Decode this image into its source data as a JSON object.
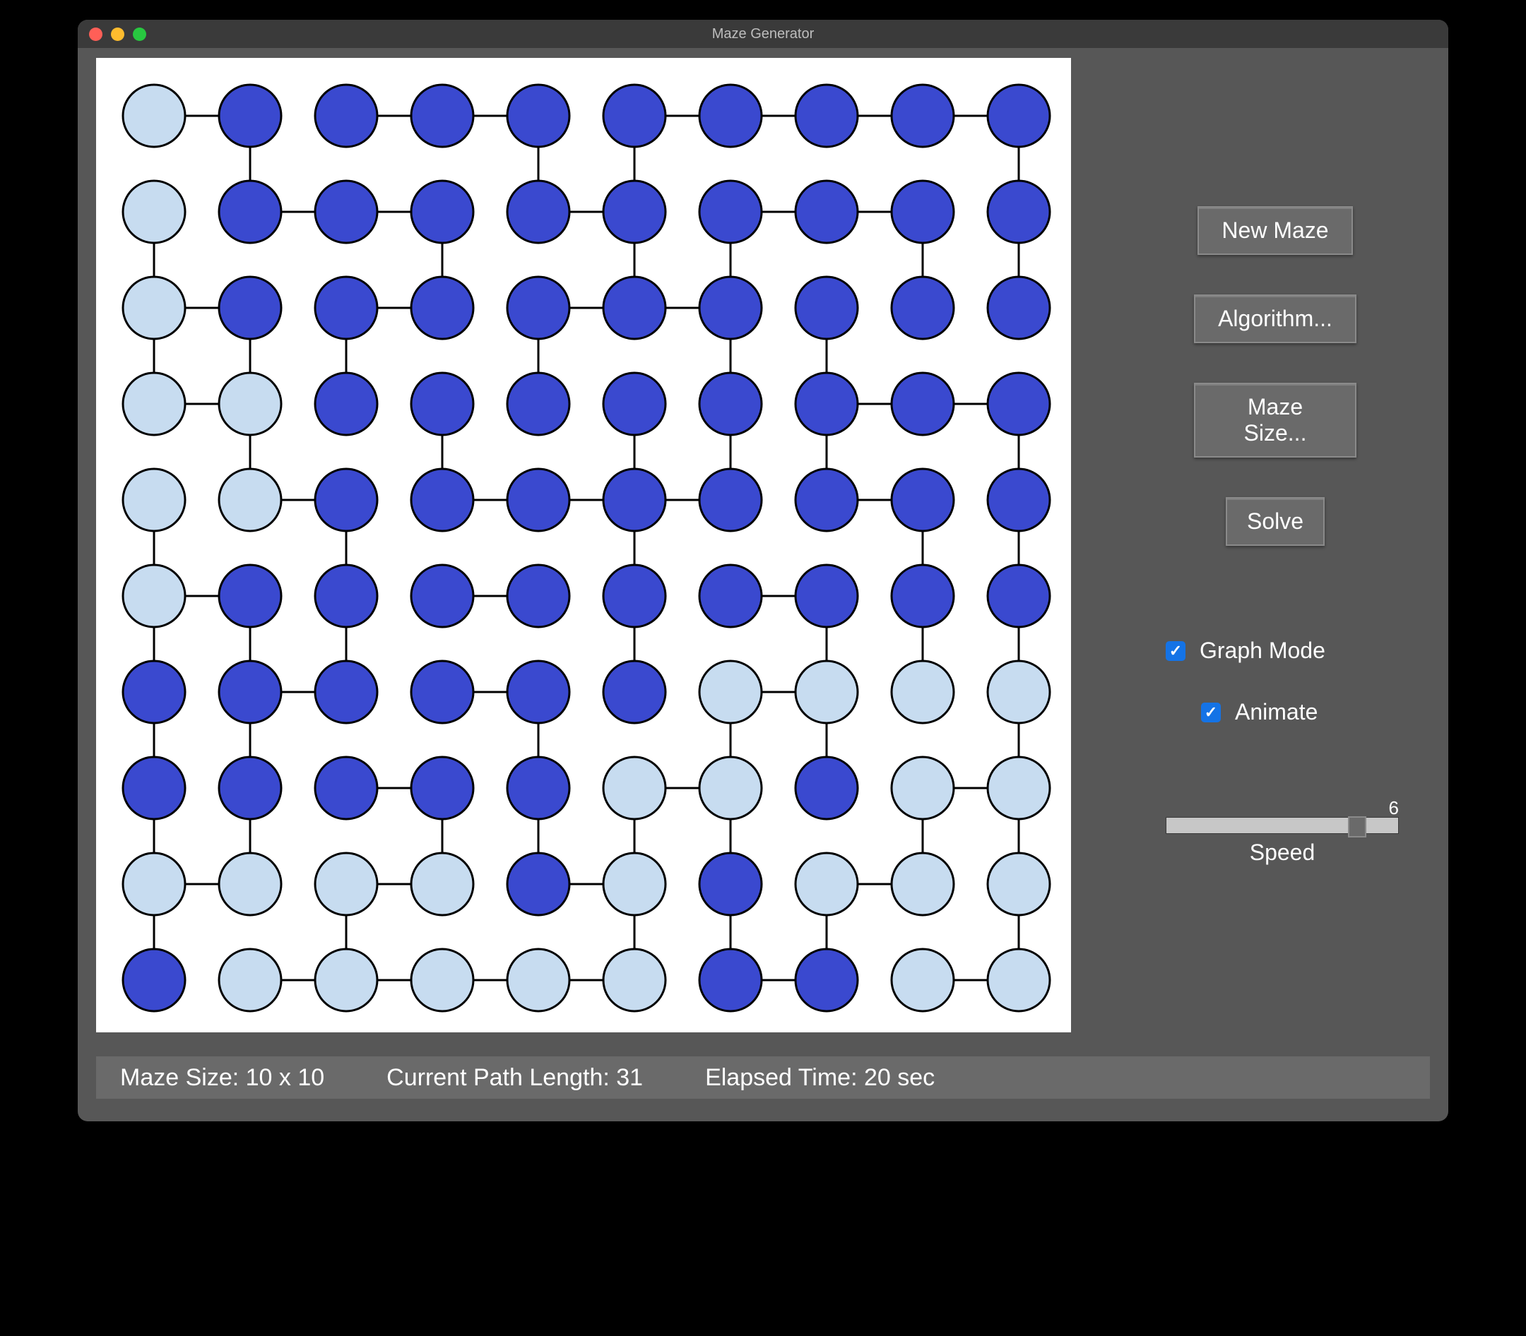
{
  "window": {
    "title": "Maze Generator"
  },
  "sidebar": {
    "new_maze": "New Maze",
    "algorithm": "Algorithm...",
    "maze_size": "Maze Size...",
    "solve": "Solve",
    "graph_mode_label": "Graph Mode",
    "graph_mode_checked": true,
    "animate_label": "Animate",
    "animate_checked": true,
    "speed_label": "Speed",
    "speed_value": "6",
    "speed_min": 1,
    "speed_max": 7
  },
  "status": {
    "maze_size": "Maze Size: 10 x 10",
    "path_length": "Current Path Length: 31",
    "elapsed": "Elapsed Time: 20 sec"
  },
  "colors": {
    "node_dark": "#3A49CF",
    "node_light": "#C7DCF0",
    "node_stroke": "#000000",
    "edge": "#000000",
    "canvas_bg": "#FFFFFF",
    "panel_bg": "#575757"
  },
  "chart_data": {
    "type": "graph",
    "grid": {
      "rows": 10,
      "cols": 10
    },
    "node_radius": 44,
    "spacing": 136,
    "offset": 82,
    "nodes_light": [
      [
        0,
        0
      ],
      [
        0,
        1
      ],
      [
        0,
        2
      ],
      [
        0,
        3
      ],
      [
        0,
        4
      ],
      [
        0,
        5
      ],
      [
        1,
        3
      ],
      [
        1,
        4
      ],
      [
        6,
        6
      ],
      [
        7,
        6
      ],
      [
        8,
        6
      ],
      [
        9,
        6
      ],
      [
        8,
        7
      ],
      [
        9,
        7
      ],
      [
        5,
        7
      ],
      [
        6,
        7
      ],
      [
        0,
        8
      ],
      [
        1,
        8
      ],
      [
        2,
        8
      ],
      [
        3,
        8
      ],
      [
        5,
        8
      ],
      [
        7,
        8
      ],
      [
        8,
        8
      ],
      [
        9,
        8
      ],
      [
        1,
        9
      ],
      [
        2,
        9
      ],
      [
        3,
        9
      ],
      [
        4,
        9
      ],
      [
        5,
        9
      ],
      [
        8,
        9
      ],
      [
        9,
        9
      ]
    ],
    "edges": [
      [
        [
          0,
          0
        ],
        [
          1,
          0
        ]
      ],
      [
        [
          2,
          0
        ],
        [
          3,
          0
        ]
      ],
      [
        [
          3,
          0
        ],
        [
          4,
          0
        ]
      ],
      [
        [
          5,
          0
        ],
        [
          6,
          0
        ]
      ],
      [
        [
          6,
          0
        ],
        [
          7,
          0
        ]
      ],
      [
        [
          7,
          0
        ],
        [
          8,
          0
        ]
      ],
      [
        [
          8,
          0
        ],
        [
          9,
          0
        ]
      ],
      [
        [
          1,
          1
        ],
        [
          2,
          1
        ]
      ],
      [
        [
          2,
          1
        ],
        [
          3,
          1
        ]
      ],
      [
        [
          4,
          1
        ],
        [
          5,
          1
        ]
      ],
      [
        [
          6,
          1
        ],
        [
          7,
          1
        ]
      ],
      [
        [
          7,
          1
        ],
        [
          8,
          1
        ]
      ],
      [
        [
          0,
          2
        ],
        [
          1,
          2
        ]
      ],
      [
        [
          2,
          2
        ],
        [
          3,
          2
        ]
      ],
      [
        [
          4,
          2
        ],
        [
          5,
          2
        ]
      ],
      [
        [
          5,
          2
        ],
        [
          6,
          2
        ]
      ],
      [
        [
          0,
          3
        ],
        [
          1,
          3
        ]
      ],
      [
        [
          7,
          3
        ],
        [
          8,
          3
        ]
      ],
      [
        [
          8,
          3
        ],
        [
          9,
          3
        ]
      ],
      [
        [
          1,
          4
        ],
        [
          2,
          4
        ]
      ],
      [
        [
          3,
          4
        ],
        [
          4,
          4
        ]
      ],
      [
        [
          4,
          4
        ],
        [
          5,
          4
        ]
      ],
      [
        [
          5,
          4
        ],
        [
          6,
          4
        ]
      ],
      [
        [
          7,
          4
        ],
        [
          8,
          4
        ]
      ],
      [
        [
          0,
          5
        ],
        [
          1,
          5
        ]
      ],
      [
        [
          3,
          5
        ],
        [
          4,
          5
        ]
      ],
      [
        [
          6,
          5
        ],
        [
          7,
          5
        ]
      ],
      [
        [
          1,
          6
        ],
        [
          2,
          6
        ]
      ],
      [
        [
          3,
          6
        ],
        [
          4,
          6
        ]
      ],
      [
        [
          6,
          6
        ],
        [
          7,
          6
        ]
      ],
      [
        [
          2,
          7
        ],
        [
          3,
          7
        ]
      ],
      [
        [
          5,
          7
        ],
        [
          6,
          7
        ]
      ],
      [
        [
          8,
          7
        ],
        [
          9,
          7
        ]
      ],
      [
        [
          0,
          8
        ],
        [
          1,
          8
        ]
      ],
      [
        [
          2,
          8
        ],
        [
          3,
          8
        ]
      ],
      [
        [
          4,
          8
        ],
        [
          5,
          8
        ]
      ],
      [
        [
          7,
          8
        ],
        [
          8,
          8
        ]
      ],
      [
        [
          1,
          9
        ],
        [
          2,
          9
        ]
      ],
      [
        [
          2,
          9
        ],
        [
          3,
          9
        ]
      ],
      [
        [
          3,
          9
        ],
        [
          4,
          9
        ]
      ],
      [
        [
          4,
          9
        ],
        [
          5,
          9
        ]
      ],
      [
        [
          6,
          9
        ],
        [
          7,
          9
        ]
      ],
      [
        [
          8,
          9
        ],
        [
          9,
          9
        ]
      ],
      [
        [
          1,
          0
        ],
        [
          1,
          1
        ]
      ],
      [
        [
          4,
          0
        ],
        [
          4,
          1
        ]
      ],
      [
        [
          5,
          0
        ],
        [
          5,
          1
        ]
      ],
      [
        [
          9,
          0
        ],
        [
          9,
          1
        ]
      ],
      [
        [
          0,
          1
        ],
        [
          0,
          2
        ]
      ],
      [
        [
          3,
          1
        ],
        [
          3,
          2
        ]
      ],
      [
        [
          5,
          1
        ],
        [
          5,
          2
        ]
      ],
      [
        [
          6,
          1
        ],
        [
          6,
          2
        ]
      ],
      [
        [
          8,
          1
        ],
        [
          8,
          2
        ]
      ],
      [
        [
          9,
          1
        ],
        [
          9,
          2
        ]
      ],
      [
        [
          0,
          2
        ],
        [
          0,
          3
        ]
      ],
      [
        [
          1,
          2
        ],
        [
          1,
          3
        ]
      ],
      [
        [
          2,
          2
        ],
        [
          2,
          3
        ]
      ],
      [
        [
          4,
          2
        ],
        [
          4,
          3
        ]
      ],
      [
        [
          6,
          2
        ],
        [
          6,
          3
        ]
      ],
      [
        [
          7,
          2
        ],
        [
          7,
          3
        ]
      ],
      [
        [
          1,
          3
        ],
        [
          1,
          4
        ]
      ],
      [
        [
          3,
          3
        ],
        [
          3,
          4
        ]
      ],
      [
        [
          5,
          3
        ],
        [
          5,
          4
        ]
      ],
      [
        [
          6,
          3
        ],
        [
          6,
          4
        ]
      ],
      [
        [
          7,
          3
        ],
        [
          7,
          4
        ]
      ],
      [
        [
          9,
          3
        ],
        [
          9,
          4
        ]
      ],
      [
        [
          0,
          4
        ],
        [
          0,
          5
        ]
      ],
      [
        [
          2,
          4
        ],
        [
          2,
          5
        ]
      ],
      [
        [
          5,
          4
        ],
        [
          5,
          5
        ]
      ],
      [
        [
          8,
          4
        ],
        [
          8,
          5
        ]
      ],
      [
        [
          9,
          4
        ],
        [
          9,
          5
        ]
      ],
      [
        [
          0,
          5
        ],
        [
          0,
          6
        ]
      ],
      [
        [
          1,
          5
        ],
        [
          1,
          6
        ]
      ],
      [
        [
          2,
          5
        ],
        [
          2,
          6
        ]
      ],
      [
        [
          5,
          5
        ],
        [
          5,
          6
        ]
      ],
      [
        [
          7,
          5
        ],
        [
          7,
          6
        ]
      ],
      [
        [
          8,
          5
        ],
        [
          8,
          6
        ]
      ],
      [
        [
          9,
          5
        ],
        [
          9,
          6
        ]
      ],
      [
        [
          0,
          6
        ],
        [
          0,
          7
        ]
      ],
      [
        [
          1,
          6
        ],
        [
          1,
          7
        ]
      ],
      [
        [
          4,
          6
        ],
        [
          4,
          7
        ]
      ],
      [
        [
          6,
          6
        ],
        [
          6,
          7
        ]
      ],
      [
        [
          7,
          6
        ],
        [
          7,
          7
        ]
      ],
      [
        [
          9,
          6
        ],
        [
          9,
          7
        ]
      ],
      [
        [
          0,
          7
        ],
        [
          0,
          8
        ]
      ],
      [
        [
          1,
          7
        ],
        [
          1,
          8
        ]
      ],
      [
        [
          3,
          7
        ],
        [
          3,
          8
        ]
      ],
      [
        [
          4,
          7
        ],
        [
          4,
          8
        ]
      ],
      [
        [
          5,
          7
        ],
        [
          5,
          8
        ]
      ],
      [
        [
          6,
          7
        ],
        [
          6,
          8
        ]
      ],
      [
        [
          8,
          7
        ],
        [
          8,
          8
        ]
      ],
      [
        [
          9,
          7
        ],
        [
          9,
          8
        ]
      ],
      [
        [
          0,
          8
        ],
        [
          0,
          9
        ]
      ],
      [
        [
          2,
          8
        ],
        [
          2,
          9
        ]
      ],
      [
        [
          5,
          8
        ],
        [
          5,
          9
        ]
      ],
      [
        [
          6,
          8
        ],
        [
          6,
          9
        ]
      ],
      [
        [
          7,
          8
        ],
        [
          7,
          9
        ]
      ],
      [
        [
          9,
          8
        ],
        [
          9,
          9
        ]
      ]
    ]
  }
}
